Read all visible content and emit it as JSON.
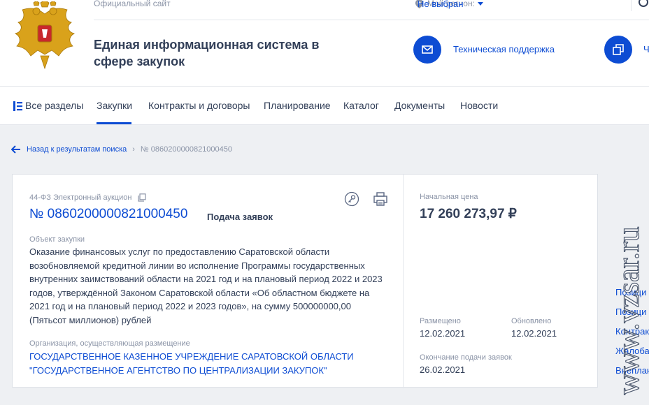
{
  "header": {
    "official_site": "Официальный сайт",
    "region_label": "Мой регион:",
    "region_value": "Не выбран",
    "title": "Единая информационная система в сфере закупок",
    "support_label": "Техническая поддержка",
    "second_link_fragment": "Ч"
  },
  "nav": {
    "all_sections": "Все разделы",
    "items": [
      "Закупки",
      "Контракты и договоры",
      "Планирование",
      "Каталог",
      "Документы",
      "Новости"
    ],
    "active": "Закупки"
  },
  "breadcrumb": {
    "back": "Назад к результатам поиска",
    "current": "№ 0860200000821000450"
  },
  "card": {
    "law_type": "44-ФЗ Электронный аукцион",
    "number": "№ 0860200000821000450",
    "status": "Подача заявок",
    "object_label": "Объект закупки",
    "object_text": "Оказание финансовых услуг по предоставлению Саратовской области возобновляемой кредитной линии во исполнение Программы государственных внутренних заимствований области на 2021 год и на плановый период 2022 и 2023 годов, утверждённой Законом Саратовской области «Об областном бюджете на 2021 год и на плановый период 2022 и 2023 годов», на сумму 500000000,00 (Пятьсот миллионов) рублей",
    "org_label": "Организация, осуществляющая размещение",
    "org_name": "ГОСУДАРСТВЕННОЕ КАЗЕННОЕ УЧРЕЖДЕНИЕ САРАТОВСКОЙ ОБЛАСТИ \"ГОСУДАРСТВЕННОЕ АГЕНТСТВО ПО ЦЕНТРАЛИЗАЦИИ ЗАКУПОК\"",
    "price_label": "Начальная цена",
    "price": "17 260 273,97 ₽",
    "posted_label": "Размещено",
    "posted": "12.02.2021",
    "updated_label": "Обновлено",
    "updated": "12.02.2021",
    "deadline_label": "Окончание подачи заявок",
    "deadline": "26.02.2021"
  },
  "right_links": [
    "Позици",
    "Позици",
    "Контрак",
    "Жалоба",
    "Внеплан"
  ],
  "watermark": "www.vzsar.ru",
  "colors": {
    "accent": "#0d4cd3",
    "text": "#334059",
    "muted": "#8a93a6",
    "background": "#eef0f3"
  }
}
